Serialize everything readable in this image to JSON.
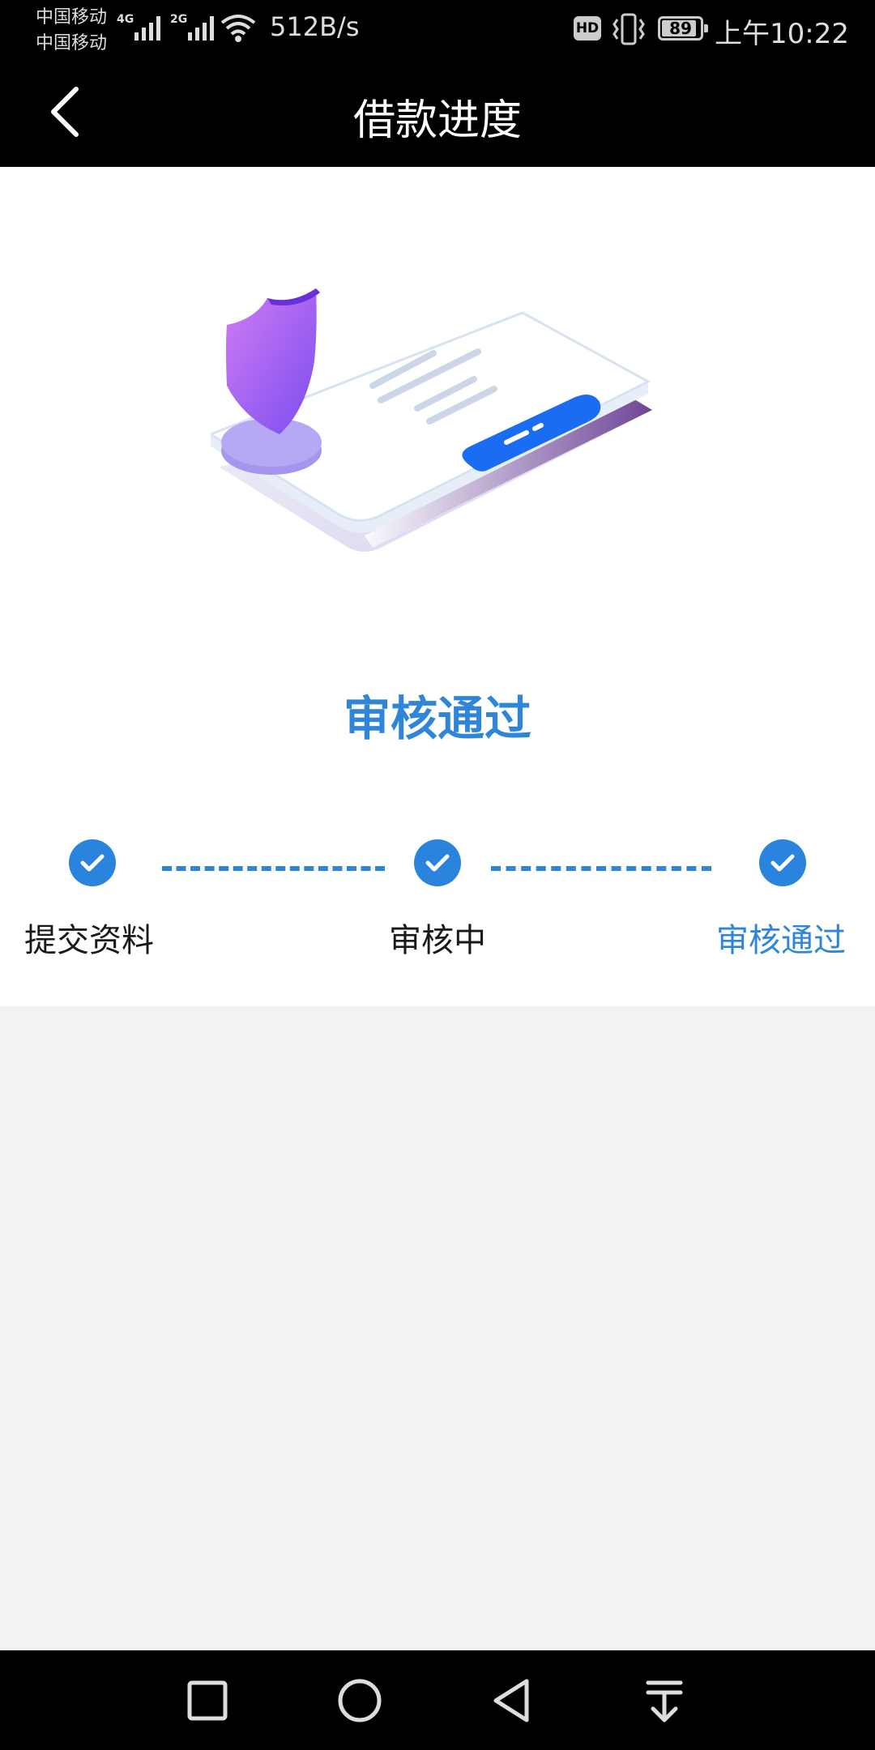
{
  "status_bar": {
    "carrier_1": "中国移动",
    "carrier_2": "中国移动",
    "network_1": "4G",
    "network_2": "2G",
    "speed": "512B/s",
    "hd_badge": "HD",
    "battery_level": "89",
    "time": "上午10:22",
    "icons": [
      "signal-icon",
      "wifi-icon",
      "hd-icon",
      "vibrate-icon",
      "battery-icon"
    ]
  },
  "header": {
    "title": "借款进度",
    "back_icon": "chevron-left-icon"
  },
  "result": {
    "title": "审核通过"
  },
  "steps": [
    {
      "label": "提交资料",
      "status": "done",
      "icon": "check-icon"
    },
    {
      "label": "审核中",
      "status": "done",
      "icon": "check-icon"
    },
    {
      "label": "审核通过",
      "status": "current",
      "icon": "check-icon"
    }
  ],
  "nav_bar": {
    "buttons": [
      "recent-apps-icon",
      "home-icon",
      "back-icon",
      "notification-pull-icon"
    ]
  },
  "colors": {
    "accent": "#2f86d8",
    "header_bg": "#000000",
    "page_bg": "#f2f2f2"
  }
}
